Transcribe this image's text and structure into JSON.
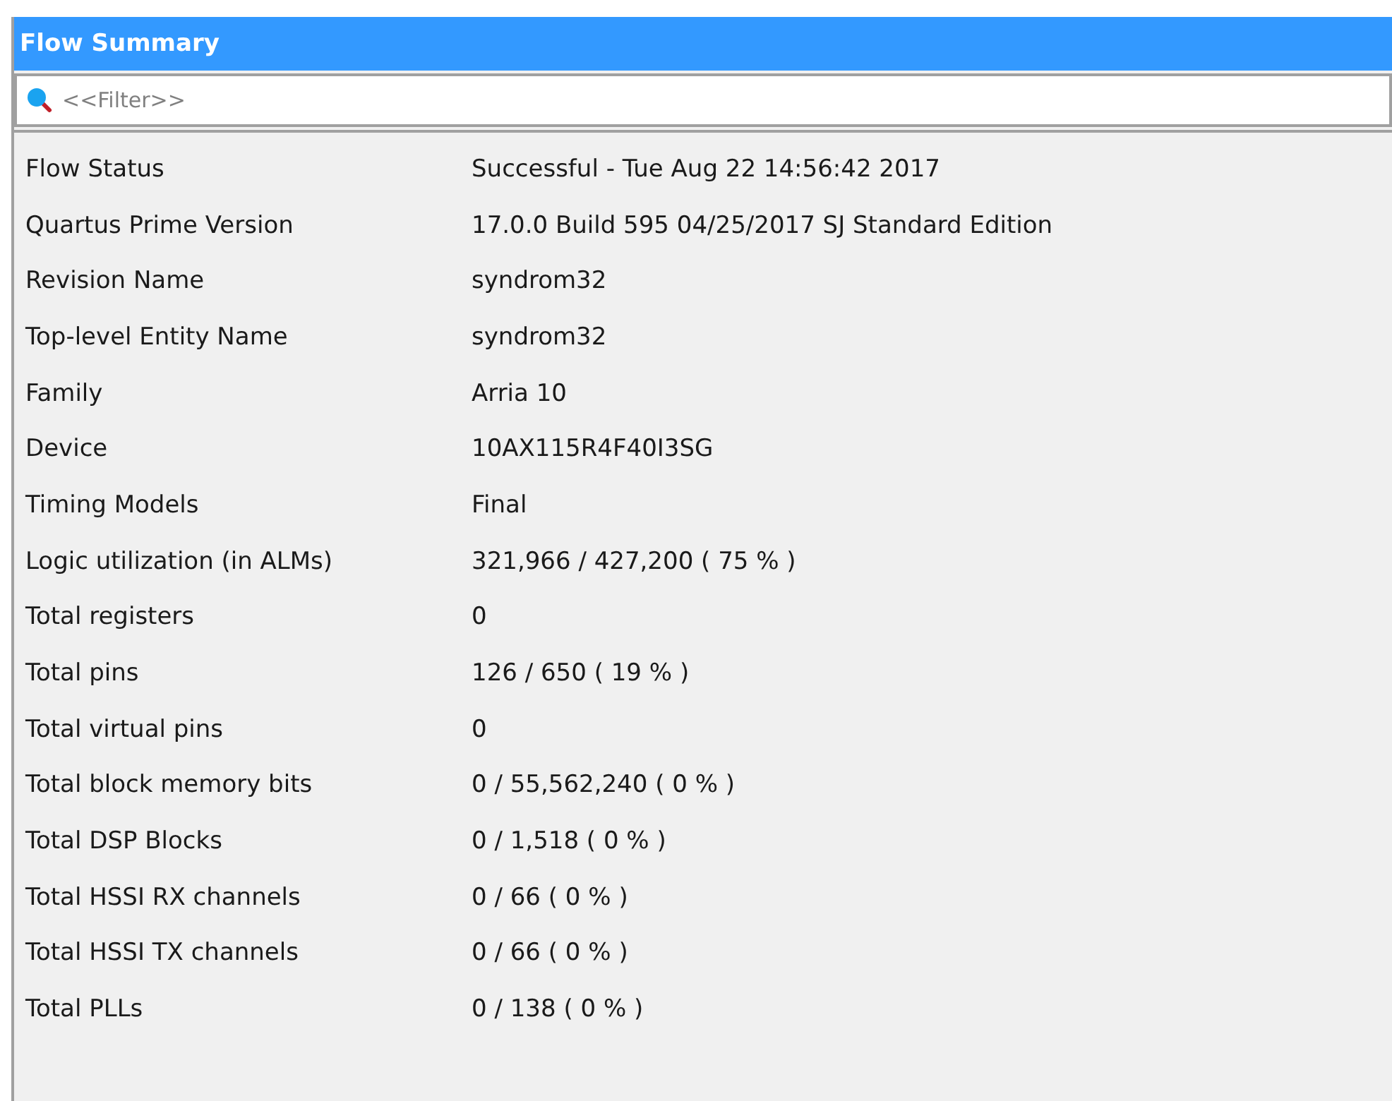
{
  "panel": {
    "title": "Flow Summary"
  },
  "filter": {
    "placeholder": "<<Filter>>"
  },
  "rows": [
    {
      "label": "Flow Status",
      "value": "Successful - Tue Aug 22 14:56:42 2017"
    },
    {
      "label": "Quartus Prime Version",
      "value": "17.0.0 Build 595 04/25/2017 SJ Standard Edition"
    },
    {
      "label": "Revision Name",
      "value": "syndrom32"
    },
    {
      "label": "Top-level Entity Name",
      "value": "syndrom32"
    },
    {
      "label": "Family",
      "value": "Arria 10"
    },
    {
      "label": "Device",
      "value": "10AX115R4F40I3SG"
    },
    {
      "label": "Timing Models",
      "value": "Final"
    },
    {
      "label": "Logic utilization (in ALMs)",
      "value": "321,966 / 427,200 ( 75 % )"
    },
    {
      "label": "Total registers",
      "value": "0"
    },
    {
      "label": "Total pins",
      "value": "126 / 650 ( 19 % )"
    },
    {
      "label": "Total virtual pins",
      "value": "0"
    },
    {
      "label": "Total block memory bits",
      "value": "0 / 55,562,240 ( 0 % )"
    },
    {
      "label": "Total DSP Blocks",
      "value": "0 / 1,518 ( 0 % )"
    },
    {
      "label": "Total HSSI RX channels",
      "value": "0 / 66 ( 0 % )"
    },
    {
      "label": "Total HSSI TX channels",
      "value": "0 / 66 ( 0 % )"
    },
    {
      "label": "Total PLLs",
      "value": "0 / 138 ( 0 % )"
    }
  ]
}
